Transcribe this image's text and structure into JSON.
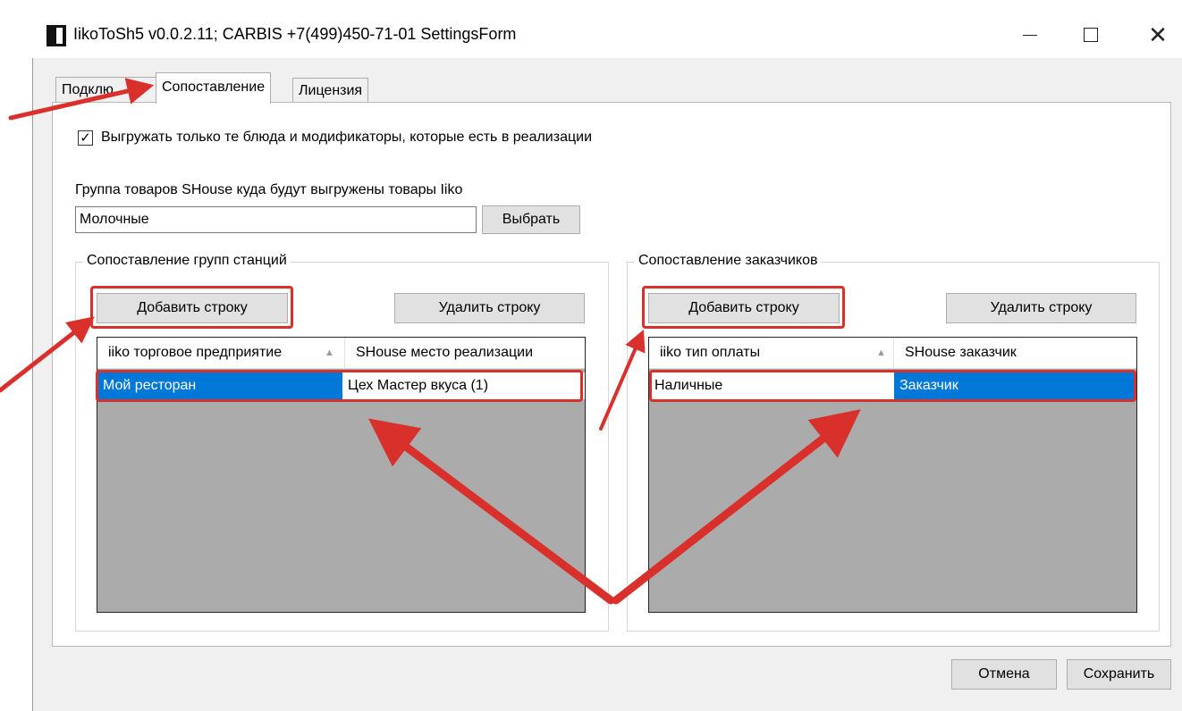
{
  "window": {
    "title": "IikoToSh5 v0.0.2.11;  CARBIS +7(499)450-71-01 SettingsForm",
    "minimize_glyph": "—",
    "maximize_glyph": "☐",
    "close_glyph": "✕"
  },
  "tabs": [
    {
      "label": "Подключение",
      "active": false
    },
    {
      "label": "Сопоставление",
      "active": true
    },
    {
      "label": "Лицензия",
      "active": false
    }
  ],
  "tab_visible_text": {
    "connection_partial": "Подклю"
  },
  "export_only_realized": {
    "label": "Выгружать только те блюда и модификаторы, которые есть в реализации",
    "checked": true
  },
  "product_group": {
    "label": "Группа товаров SHouse куда будут выгружены товары Iiko",
    "value": "Молочные",
    "select_button": "Выбрать"
  },
  "station_mapping": {
    "title": "Сопоставление групп станций",
    "add_button": "Добавить строку",
    "delete_button": "Удалить строку",
    "columns": [
      "iiko торговое предприятие",
      "SHouse место реализации"
    ],
    "rows": [
      [
        "Мой ресторан",
        "Цех Мастер вкуса (1)"
      ]
    ]
  },
  "customer_mapping": {
    "title": "Сопоставление заказчиков",
    "add_button": "Добавить строку",
    "delete_button": "Удалить строку",
    "columns": [
      "iiko тип оплаты",
      "SHouse заказчик"
    ],
    "rows": [
      [
        "Наличные",
        "Заказчик"
      ]
    ]
  },
  "footer": {
    "cancel_button": "Отмена",
    "save_button": "Сохранить"
  },
  "colors": {
    "selection": "#0078d7",
    "annotation_red": "#d9302c",
    "grid_empty": "#ababab"
  }
}
